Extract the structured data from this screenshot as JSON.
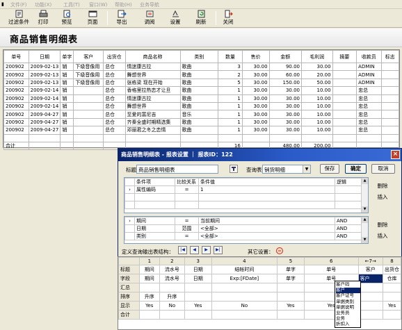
{
  "menu": [
    "文件(F)",
    "功能(X)",
    "工具(T)",
    "窗口(W)",
    "帮助(H)",
    "业务导航"
  ],
  "toolbar": {
    "filter": "过滤条件",
    "print": "打印",
    "preview": "预览",
    "page": "页面",
    "export": "导出",
    "align": "调阅",
    "settings": "设置",
    "refresh": "刷新",
    "close": "关闭"
  },
  "page_title": "商品销售明细表",
  "grid": {
    "headers": [
      "单号",
      "日期",
      "单字",
      "客户",
      "出货仓",
      "商品名称",
      "类别",
      "数量",
      "售价",
      "金额",
      "毛利润",
      "摘要",
      "收款员",
      "标志"
    ],
    "rows": [
      [
        "200902",
        "2009-02-13",
        "销",
        "下级音像用",
        "总仓",
        "情迷康古拉",
        "歌曲",
        "3",
        "30.00",
        "90.00",
        "30.00",
        "",
        "ADMIN",
        ""
      ],
      [
        "200902",
        "2009-02-13",
        "销",
        "下级音像用",
        "总仓",
        "舞想世界",
        "歌曲",
        "2",
        "30.00",
        "60.00",
        "20.00",
        "",
        "ADMIN",
        ""
      ],
      [
        "200902",
        "2009-02-13",
        "销",
        "下级音像用",
        "总仓",
        "张栋梁 现在开始",
        "歌曲",
        "5",
        "30.00",
        "150.00",
        "50.00",
        "",
        "ADMIN",
        ""
      ],
      [
        "200902",
        "2009-02-14",
        "销",
        "",
        "总仓",
        "香格里拉热恋才让旦",
        "歌曲",
        "1",
        "30.00",
        "30.00",
        "10.00",
        "",
        "忠总",
        ""
      ],
      [
        "200902",
        "2009-02-14",
        "销",
        "",
        "总仓",
        "情迷康古拉",
        "歌曲",
        "1",
        "30.00",
        "30.00",
        "10.00",
        "",
        "忠总",
        ""
      ],
      [
        "200902",
        "2009-02-14",
        "销",
        "",
        "总仓",
        "舞想世界",
        "歌曲",
        "1",
        "30.00",
        "30.00",
        "10.00",
        "",
        "忠总",
        ""
      ],
      [
        "200902",
        "2009-04-27",
        "销",
        "",
        "总仓",
        "至爱的富尼吉",
        "音乐",
        "1",
        "30.00",
        "30.00",
        "10.00",
        "",
        "忠总",
        ""
      ],
      [
        "200902",
        "2009-04-27",
        "销",
        "",
        "总仓",
        "齐秦全盛时期精选集",
        "歌曲",
        "1",
        "30.00",
        "30.00",
        "10.00",
        "",
        "忠总",
        ""
      ],
      [
        "200902",
        "2009-04-27",
        "销",
        "",
        "总仓",
        "邓丽君之冬之恋情",
        "歌曲",
        "1",
        "30.00",
        "30.00",
        "10.00",
        "",
        "忠总",
        ""
      ]
    ],
    "total_label": "合计",
    "total_qty": "16",
    "total_amount": "480.00",
    "total_profit": "200.00"
  },
  "dialog": {
    "title": "商品销售明细表 - 报表设置 ｜ 报表ID：122",
    "title_label": "标题",
    "title_value": "商品销售明细表",
    "query_label": "查询表",
    "query_value": "销货明细",
    "save": "保存",
    "ok": "确定",
    "cancel": "取消",
    "cond_headers": [
      "条件项",
      "比较关系",
      "条件值",
      "逻辑"
    ],
    "cond_rows": [
      [
        "属性编码",
        "=",
        "1",
        ""
      ]
    ],
    "cond2_rows": [
      [
        "期间",
        "=",
        "当前期间",
        "AND"
      ],
      [
        "日期",
        "范围",
        "<全部>",
        "AND"
      ],
      [
        "类别",
        "=",
        "<全部>",
        "AND"
      ]
    ],
    "delete": "删除",
    "insert": "插入",
    "define_label": "定义查询输出表结构：",
    "other_label": "其它设置："
  },
  "struct": {
    "col_nums": [
      "1",
      "2",
      "3",
      "4",
      "5",
      "6",
      "7",
      "8"
    ],
    "arrow": "←7→",
    "rows": [
      [
        "标题",
        "期间",
        "流水号",
        "日期",
        "结帐时间",
        "单字",
        "单号",
        "客户",
        "出货仓"
      ],
      [
        "字段",
        "期间",
        "流水号",
        "日期",
        "Exp:[FDate]",
        "单字",
        "单号",
        "客户",
        "仓库"
      ],
      [
        "汇总",
        "",
        "",
        "",
        "",
        "",
        "",
        "",
        ""
      ],
      [
        "排序",
        "升序",
        "升序",
        "",
        "",
        "",
        "",
        "",
        ""
      ],
      [
        "显示",
        "Yes",
        "No",
        "Yes",
        "No",
        "Yes",
        "Yes",
        "",
        "Yes"
      ],
      [
        "合计",
        "",
        "",
        "",
        "",
        "",
        "",
        "",
        ""
      ]
    ]
  },
  "dropdown_options": [
    "客户码",
    "客户",
    "客户证号",
    "单据类别",
    "单据说明",
    "业务员",
    "业务",
    "折扣入"
  ],
  "colors": {
    "selection": "#0a246a",
    "dialog_title": "#0a246a"
  }
}
